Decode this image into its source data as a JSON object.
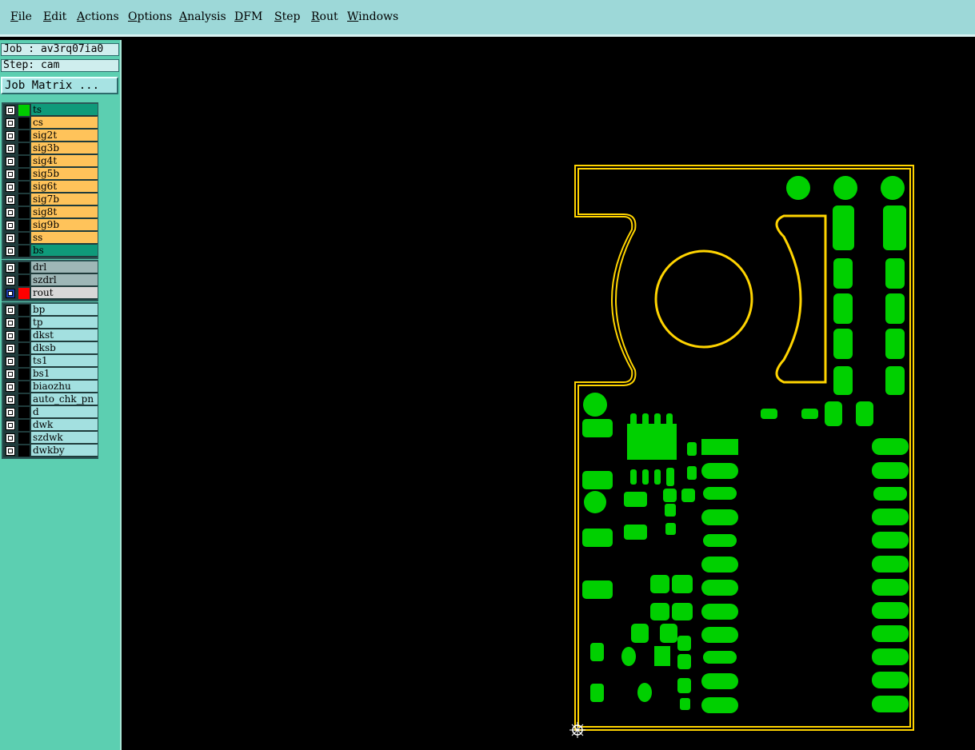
{
  "menu": [
    "File",
    "Edit",
    "Actions",
    "Options",
    "Analysis",
    "DFM",
    "Step",
    "Rout",
    "Windows"
  ],
  "job_label": "Job : av3rq07ia0",
  "step_label": "Step: cam",
  "job_matrix_button": "Job Matrix ...",
  "colors": {
    "menubar": "#9dd8d8",
    "panel": "#5ccfb1",
    "layer_board": "#0f9a7a",
    "layer_signal": "#ffc35a",
    "layer_drill": "#9eb7b7",
    "layer_doc": "#a3e0e0",
    "pcb_pad": "#00d000",
    "pcb_outline": "#ffd400"
  },
  "layer_groups": [
    {
      "layers": [
        {
          "name": "ts",
          "bg": "#0f9a7a",
          "swatch": "#00cc00"
        },
        {
          "name": "cs",
          "bg": "#ffc35a",
          "swatch": "#000000"
        },
        {
          "name": "sig2t",
          "bg": "#ffc35a",
          "swatch": "#000000"
        },
        {
          "name": "sig3b",
          "bg": "#ffc35a",
          "swatch": "#000000"
        },
        {
          "name": "sig4t",
          "bg": "#ffc35a",
          "swatch": "#000000"
        },
        {
          "name": "sig5b",
          "bg": "#ffc35a",
          "swatch": "#000000"
        },
        {
          "name": "sig6t",
          "bg": "#ffc35a",
          "swatch": "#000000"
        },
        {
          "name": "sig7b",
          "bg": "#ffc35a",
          "swatch": "#000000"
        },
        {
          "name": "sig8t",
          "bg": "#ffc35a",
          "swatch": "#000000"
        },
        {
          "name": "sig9b",
          "bg": "#ffc35a",
          "swatch": "#000000"
        },
        {
          "name": "ss",
          "bg": "#ffc35a",
          "swatch": "#000000"
        },
        {
          "name": "bs",
          "bg": "#0f9a7a",
          "swatch": "#000000"
        }
      ]
    },
    {
      "layers": [
        {
          "name": "drl",
          "bg": "#9eb7b7",
          "swatch": "#000000"
        },
        {
          "name": "szdrl",
          "bg": "#9eb7b7",
          "swatch": "#000000"
        },
        {
          "name": "rout",
          "bg": "#d8d8d8",
          "swatch": "#ff0000",
          "selected": true
        }
      ]
    },
    {
      "layers": [
        {
          "name": "bp",
          "bg": "#a3e0e0",
          "swatch": "#000000"
        },
        {
          "name": "tp",
          "bg": "#a3e0e0",
          "swatch": "#000000"
        },
        {
          "name": "dkst",
          "bg": "#a3e0e0",
          "swatch": "#000000"
        },
        {
          "name": "dksb",
          "bg": "#a3e0e0",
          "swatch": "#000000"
        },
        {
          "name": "ts1",
          "bg": "#a3e0e0",
          "swatch": "#000000"
        },
        {
          "name": "bs1",
          "bg": "#a3e0e0",
          "swatch": "#000000"
        },
        {
          "name": "biaozhu",
          "bg": "#a3e0e0",
          "swatch": "#000000"
        },
        {
          "name": "auto_chk_pn",
          "bg": "#a3e0e0",
          "swatch": "#000000"
        },
        {
          "name": "d",
          "bg": "#a3e0e0",
          "swatch": "#000000"
        },
        {
          "name": "dwk",
          "bg": "#a3e0e0",
          "swatch": "#000000"
        },
        {
          "name": "szdwk",
          "bg": "#a3e0e0",
          "swatch": "#000000"
        },
        {
          "name": "dwkby",
          "bg": "#a3e0e0",
          "swatch": "#000000"
        }
      ]
    }
  ]
}
